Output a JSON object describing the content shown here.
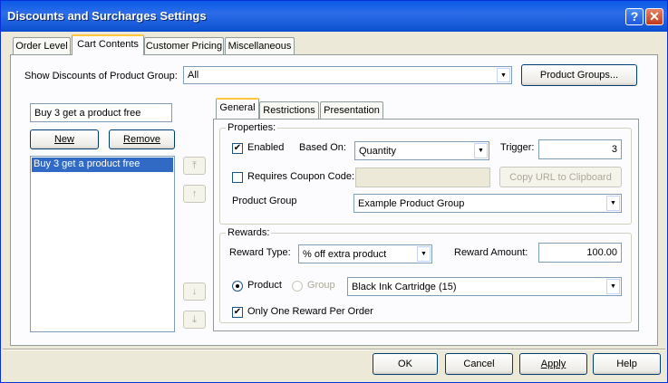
{
  "window": {
    "title": "Discounts and Surcharges Settings",
    "help_glyph": "?",
    "close_glyph": "✕"
  },
  "tabs": [
    "Order Level",
    "Cart Contents",
    "Customer Pricing",
    "Miscellaneous"
  ],
  "show_group": {
    "label": "Show Discounts of Product Group:",
    "value": "All",
    "button": "Product Groups..."
  },
  "discount_list": {
    "name_value": "Buy 3 get a product free",
    "new": "New",
    "remove": "Remove",
    "items": [
      "Buy 3 get a product free"
    ]
  },
  "move_buttons": {
    "top": "⤒",
    "up": "↑",
    "down": "↓",
    "bottom": "⤓"
  },
  "inner_tabs": [
    "General",
    "Restrictions",
    "Presentation"
  ],
  "properties": {
    "legend": "Properties:",
    "enabled_label": "Enabled",
    "based_on_label": "Based On:",
    "based_on_value": "Quantity",
    "trigger_label": "Trigger:",
    "trigger_value": "3",
    "coupon_label": "Requires Coupon Code:",
    "coupon_value": "",
    "copy_url": "Copy URL to Clipboard",
    "product_group_label": "Product Group",
    "product_group_value": "Example Product Group"
  },
  "rewards": {
    "legend": "Rewards:",
    "type_label": "Reward Type:",
    "type_value": "% off extra product",
    "amount_label": "Reward Amount:",
    "amount_value": "100.00",
    "product_label": "Product",
    "group_label": "Group",
    "product_value": "Black Ink Cartridge (15)",
    "one_reward_label": "Only One Reward Per Order"
  },
  "footer": {
    "ok": "OK",
    "cancel": "Cancel",
    "apply": "Apply",
    "help": "Help"
  },
  "check_glyph": "✔",
  "dropdown_glyph": "▼"
}
